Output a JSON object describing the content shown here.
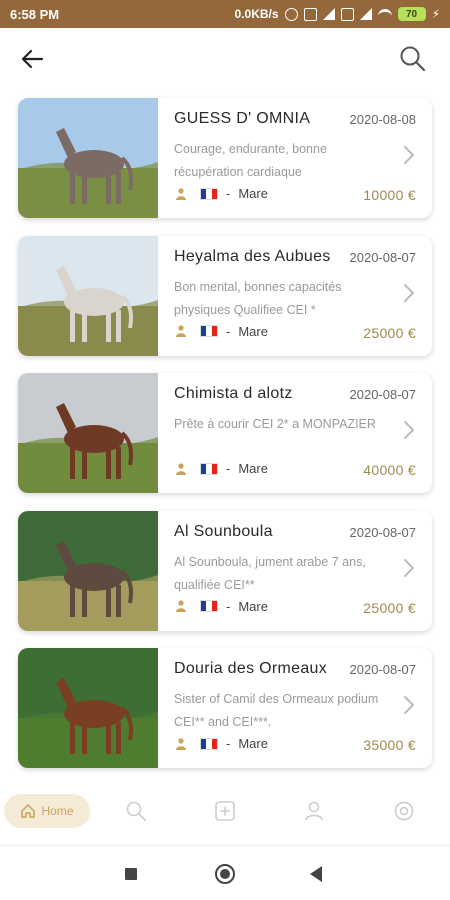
{
  "status_bar": {
    "time": "6:58 PM",
    "network_speed": "0.0KB/s",
    "battery_level": "70"
  },
  "top_bar": {
    "back_icon": "arrow-left-icon",
    "search_icon": "search-icon"
  },
  "listings": [
    {
      "name": "GUESS   D' OMNIA",
      "date": "2020-08-08",
      "description": "Courage, endurante, bonne récupération cardiaque",
      "flag": "france",
      "gender": "Mare",
      "price": "10000 €",
      "photo_colors": {
        "sky": "#a9c9e8",
        "ground": "#7a8f44",
        "horse": "#7c6a64"
      }
    },
    {
      "name": "Heyalma des  Aubues",
      "date": "2020-08-07",
      "description": "Bon mental, bonnes capacités physiques  Qualifiee CEI *",
      "flag": "france",
      "gender": "Mare",
      "price": "25000 €",
      "photo_colors": {
        "sky": "#dbe6ef",
        "ground": "#8a8a4c",
        "horse": "#d9d4ce"
      }
    },
    {
      "name": "Chimista d alotz",
      "date": "2020-08-07",
      "description": "Prête à courir CEI 2* a MONPAZIER",
      "flag": "france",
      "gender": "Mare",
      "price": "40000 €",
      "photo_colors": {
        "sky": "#c8cbcf",
        "ground": "#6f8c3f",
        "horse": "#6e3a24"
      }
    },
    {
      "name": "Al Sounboula",
      "date": "2020-08-07",
      "description": "Al Sounboula, jument arabe 7 ans, qualifiée CEI**",
      "flag": "france",
      "gender": "Mare",
      "price": "25000 €",
      "photo_colors": {
        "sky": "#3f6b3a",
        "ground": "#a39c5c",
        "horse": "#5e4a3f"
      }
    },
    {
      "name": "Douria des Ormeaux",
      "date": "2020-08-07",
      "description": "Sister of Camil des Ormeaux podium  CEI** and CEI***.",
      "flag": "france",
      "gender": "Mare",
      "price": "35000 €",
      "photo_colors": {
        "sky": "#3d6e33",
        "ground": "#4f7d2f",
        "horse": "#7a3e22"
      }
    }
  ],
  "bottom_nav": {
    "home_label": "Home",
    "items": [
      "home-icon",
      "search-icon",
      "add-icon",
      "profile-icon",
      "settings-icon"
    ]
  },
  "colors": {
    "accent_brown": "#94683a",
    "price_gold": "#a18a4f",
    "home_pill": "#f4ead6"
  }
}
